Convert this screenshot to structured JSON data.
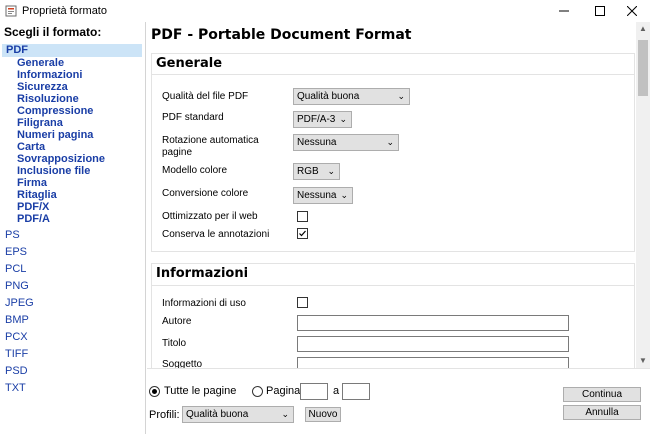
{
  "window": {
    "title": "Proprietà formato"
  },
  "sidebar": {
    "title": "Scegli il formato:",
    "selected": "PDF",
    "pdf_subitems": [
      "Generale",
      "Informazioni",
      "Sicurezza",
      "Risoluzione",
      "Compressione",
      "Filigrana",
      "Numeri pagina",
      "Carta",
      "Sovrapposizione",
      "Inclusione file",
      "Firma",
      "Ritaglia",
      "PDF/X",
      "PDF/A"
    ],
    "formats": [
      "PS",
      "EPS",
      "PCL",
      "PNG",
      "JPEG",
      "BMP",
      "PCX",
      "TIFF",
      "PSD",
      "TXT"
    ]
  },
  "main": {
    "title": "PDF - Portable Document Format",
    "generale": {
      "title": "Generale",
      "quality_label": "Qualità del file PDF",
      "quality_value": "Qualità buona",
      "standard_label": "PDF standard",
      "standard_value": "PDF/A-3",
      "rotation_label": "Rotazione automatica pagine",
      "rotation_value": "Nessuna",
      "color_model_label": "Modello colore",
      "color_model_value": "RGB",
      "color_conv_label": "Conversione colore",
      "color_conv_value": "Nessuna",
      "web_opt_label": "Ottimizzato per il web",
      "web_opt_checked": false,
      "annotations_label": "Conserva le annotazioni",
      "annotations_checked": true
    },
    "informazioni": {
      "title": "Informazioni",
      "usage_label": "Informazioni di uso",
      "usage_checked": false,
      "author_label": "Autore",
      "title_label": "Titolo",
      "subject_label": "Soggetto"
    }
  },
  "footer": {
    "all_pages_label": "Tutte le pagine",
    "page_label": "Pagina",
    "to_label": "a",
    "profiles_label": "Profili:",
    "profile_value": "Qualità buona",
    "new_label": "Nuovo",
    "continue_label": "Continua",
    "cancel_label": "Annulla"
  },
  "colors": {
    "link": "#1a3ea6",
    "selection": "#cce4f7"
  }
}
